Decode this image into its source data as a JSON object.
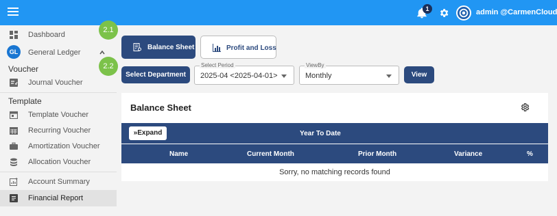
{
  "header": {
    "notification_count": "1",
    "user_name": "admin @CarmenCloud"
  },
  "sidebar": {
    "dashboard": "Dashboard",
    "gl_badge": "GL",
    "general_ledger": "General Ledger",
    "voucher_section": "Voucher",
    "journal_voucher": "Journal Voucher",
    "template_section": "Template",
    "template_voucher": "Template Voucher",
    "recurring_voucher": "Recurring Voucher",
    "amortization_voucher": "Amortization Voucher",
    "allocation_voucher": "Allocation Voucher",
    "account_summary": "Account Summary",
    "financial_report": "Financial Report"
  },
  "steps": {
    "step1": "2.1",
    "step2": "2.2"
  },
  "toolbar": {
    "balance_sheet_label": "Balance Sheet",
    "profit_loss_label": "Profit and Loss",
    "select_department_label": "Select Department",
    "view_label": "View"
  },
  "filters": {
    "period_legend": "Select Period",
    "period_value": "2025-04 <2025-04-01>",
    "viewby_legend": "ViewBy",
    "viewby_value": "Monthly"
  },
  "card": {
    "title": "Balance Sheet",
    "expand_label": "»Expand",
    "year_to_date": "Year To Date",
    "columns": [
      "Name",
      "Current Month",
      "Prior Month",
      "Variance",
      "%"
    ],
    "empty_message": "Sorry, no matching records found"
  },
  "colors": {
    "topbar": "#2196f3",
    "primary_dark": "#2c4a7e",
    "step_green": "#7cc24a"
  }
}
